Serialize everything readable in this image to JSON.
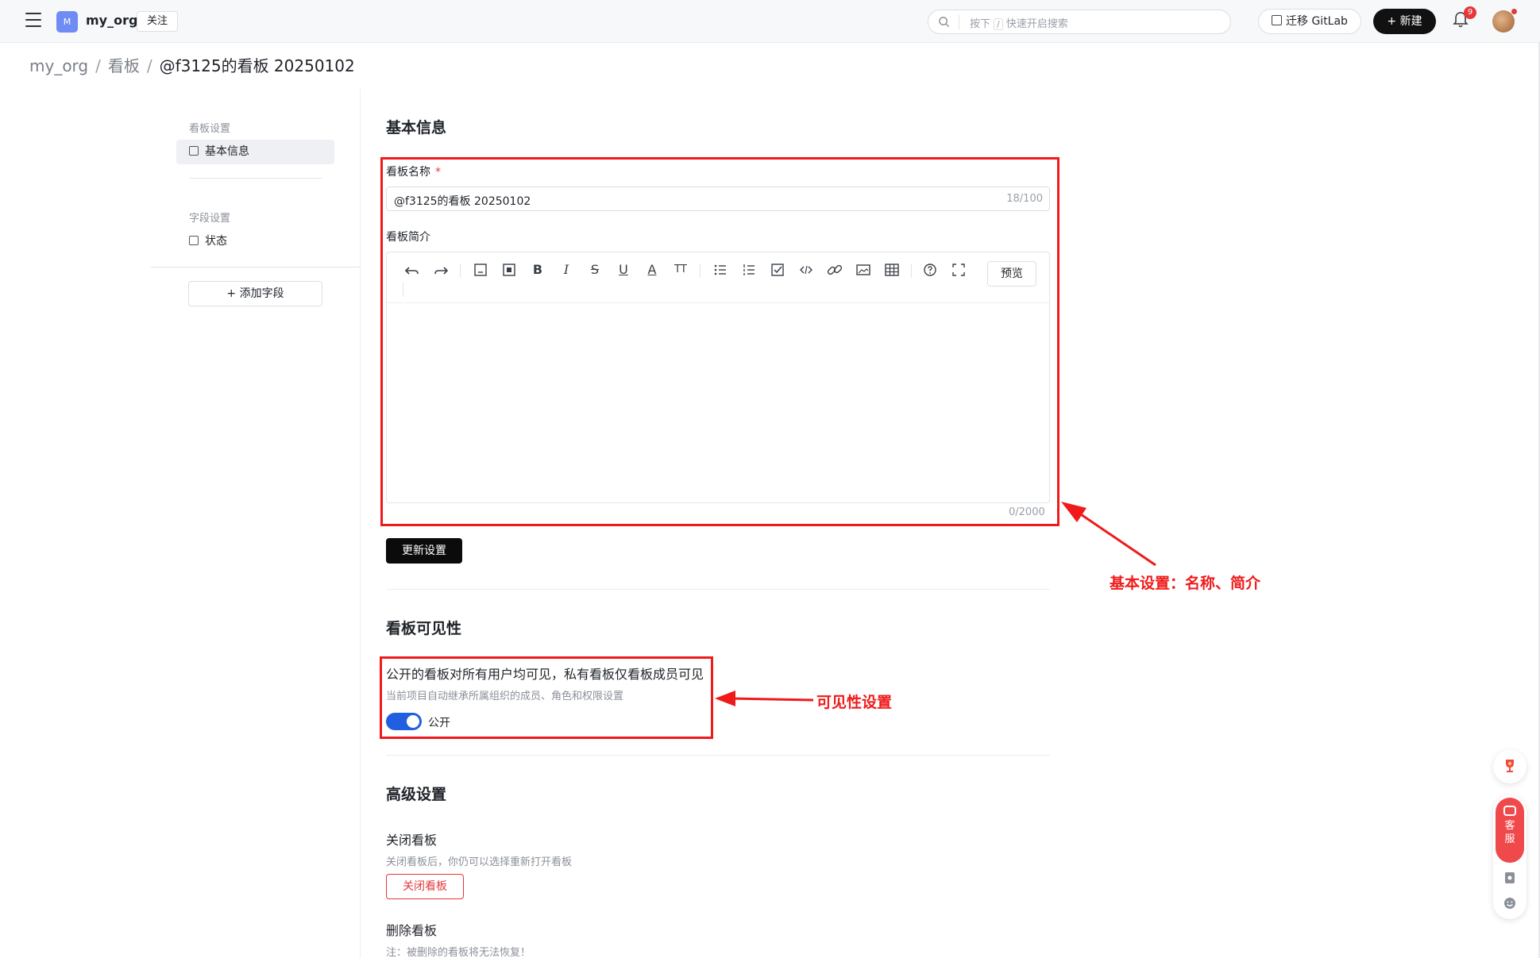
{
  "topbar": {
    "org_initial": "M",
    "org_name": "my_org",
    "follow_label": "关注",
    "search_prefix": "按下",
    "search_key": "/",
    "search_suffix": "快速开启搜索",
    "migrate_label": "迁移 GitLab",
    "new_label": "+ 新建",
    "notification_count": "9"
  },
  "breadcrumb": {
    "items": [
      "my_org",
      "看板",
      "@f3125的看板 20250102"
    ]
  },
  "sidebar": {
    "group1": "看板设置",
    "item_basic": "基本信息",
    "group2": "字段设置",
    "item_status": "状态",
    "add_field": "+ 添加字段"
  },
  "basic": {
    "title": "基本信息",
    "name_label": "看板名称",
    "name_required": "*",
    "name_value": "@f3125的看板 20250102",
    "name_count": "18/100",
    "desc_label": "看板简介",
    "preview_label": "预览",
    "desc_count": "0/2000",
    "update_label": "更新设置"
  },
  "visibility": {
    "title": "看板可见性",
    "description": "公开的看板对所有用户均可见，私有看板仅看板成员可见",
    "note": "当前项目自动继承所属组织的成员、角色和权限设置",
    "toggle_label": "公开",
    "is_public": true
  },
  "advanced": {
    "title": "高级设置",
    "close_heading": "关闭看板",
    "close_note": "关闭看板后，你仍可以选择重新打开看板",
    "close_button": "关闭看板",
    "delete_heading": "删除看板",
    "delete_note": "注：被删除的看板将无法恢复！"
  },
  "annotations": {
    "basic_label": "基本设置：名称、简介",
    "visibility_label": "可见性设置"
  },
  "float_widget": {
    "support_label_1": "客",
    "support_label_2": "服"
  },
  "colors": {
    "annotation_red": "#f01a1a",
    "toggle_blue": "#1f5fe0",
    "danger": "#e5383b",
    "primary_dark": "#0b0b0c"
  }
}
